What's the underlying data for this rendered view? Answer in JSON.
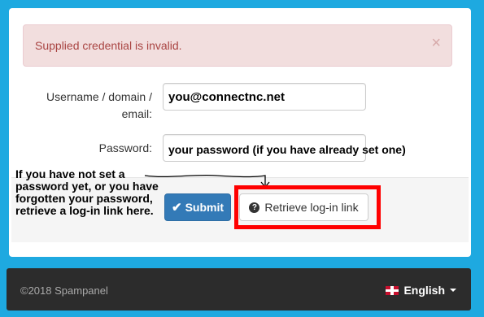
{
  "alert": {
    "message": "Supplied credential is invalid.",
    "close": "×"
  },
  "form": {
    "username_label": "Username / domain / email:",
    "username_value": "you@connectnc.net",
    "password_label": "Password:",
    "password_value": "your password (if you have already set one)",
    "submit_label": "Submit",
    "retrieve_label": "Retrieve log-in link"
  },
  "annotation": {
    "text": "If you have not set a password yet, or you have forgotten your password, retrieve a log-in link here.",
    "highlight_color": "#ff0000"
  },
  "footer": {
    "copyright": "©2018 Spampanel",
    "language": "English"
  },
  "icons": {
    "check": "check-icon",
    "question": "question-circle-icon",
    "close": "close-icon",
    "flag": "uk-flag-icon",
    "caret": "caret-down-icon"
  },
  "colors": {
    "page_bg": "#1ea9e0",
    "alert_bg": "#f2dede",
    "alert_text": "#a94442",
    "primary": "#337ab7",
    "footer_bg": "#2c2c2c"
  }
}
